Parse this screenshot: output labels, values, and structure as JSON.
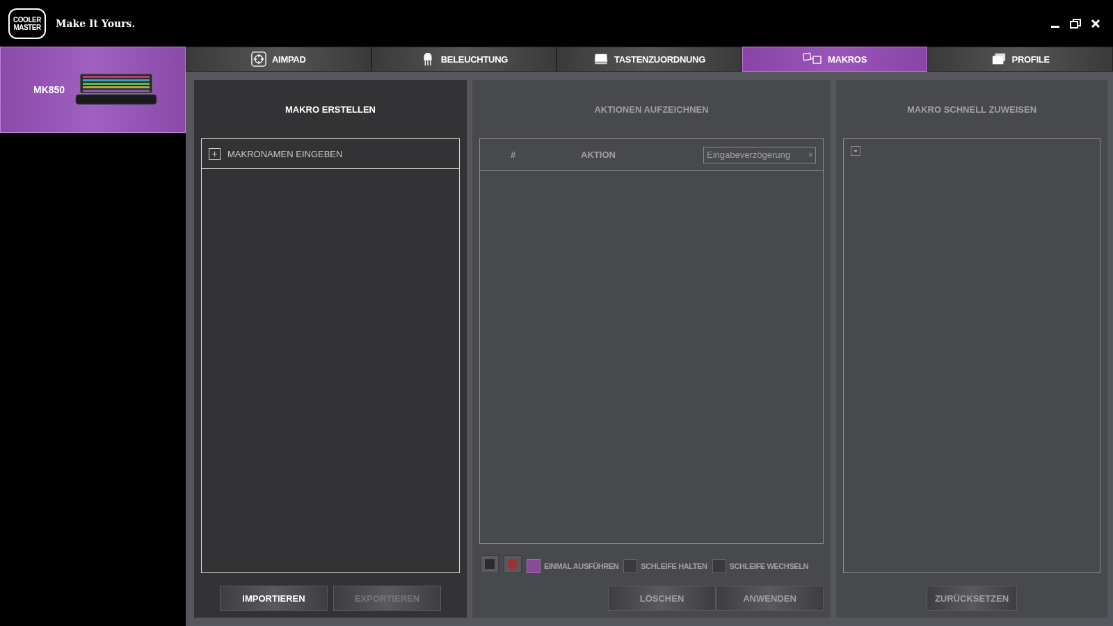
{
  "header": {
    "logo": [
      "COOLER",
      "MASTER"
    ],
    "slogan": "Make It Yours."
  },
  "sidebar": {
    "devices": [
      {
        "name": "MK850",
        "selected": true
      }
    ]
  },
  "tabs": [
    {
      "label": "AIMPAD",
      "selected": false
    },
    {
      "label": "BELEUCHTUNG",
      "selected": false
    },
    {
      "label": "TASTENZUORDNUNG",
      "selected": false
    },
    {
      "label": "MAKROS",
      "selected": true
    },
    {
      "label": "PROFILE",
      "selected": false
    }
  ],
  "create_panel": {
    "title": "MAKRO ERSTELLEN",
    "disabled": false,
    "name_field": {
      "icon": "+",
      "placeholder": "MAKRONAMEN EINGEBEN"
    },
    "buttons": [
      {
        "label": "IMPORTIEREN",
        "disabled": false
      },
      {
        "label": "EXPORTIEREN",
        "disabled": true
      }
    ]
  },
  "record_panel": {
    "title": "AKTIONEN AUFZEICHNEN",
    "disabled": true,
    "table": {
      "columns": [
        "#",
        "AKTION"
      ],
      "delay_select": "Eingabeverzögerung"
    },
    "options": [
      {
        "kind": "stop",
        "checked": false
      },
      {
        "kind": "record",
        "checked": false
      },
      {
        "kind": "check",
        "label": "EINMAL AUSFÜHREN",
        "checked": true
      },
      {
        "kind": "check",
        "label": "SCHLEIFE HALTEN",
        "checked": false
      },
      {
        "kind": "check",
        "label": "SCHLEIFE WECHSELN",
        "checked": false
      }
    ],
    "buttons": [
      {
        "label": "LÖSCHEN",
        "disabled": true
      },
      {
        "label": "ANWENDEN",
        "disabled": true
      }
    ]
  },
  "assign_panel": {
    "title": "MAKRO SCHNELL ZUWEISEN",
    "disabled": true,
    "buttons": [
      {
        "label": "ZURÜCKSETZEN",
        "disabled": true
      }
    ]
  }
}
